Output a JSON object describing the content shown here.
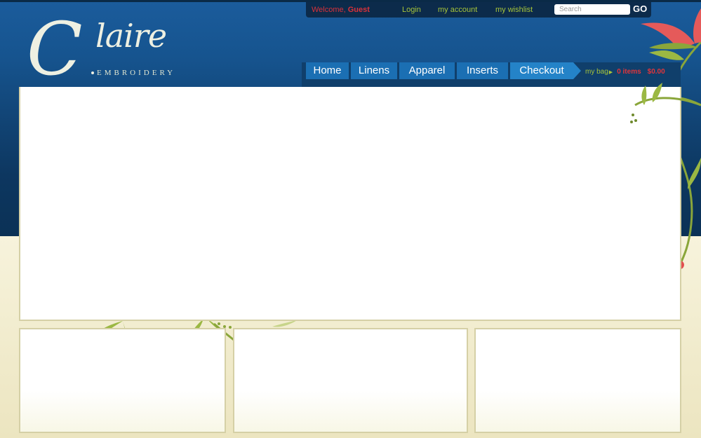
{
  "top_bar": {
    "welcome_label": "Welcome,",
    "user_name": "Guest",
    "login": "Login",
    "my_account": "my account",
    "my_wishlist": "my wishlist",
    "search_placeholder": "Search",
    "go_label": "GO"
  },
  "logo": {
    "initial": "C",
    "name": "laire",
    "tagline": "EMBROIDERY"
  },
  "nav": {
    "items": [
      "Home",
      "Linens",
      "Apparel",
      "Inserts",
      "Checkout"
    ]
  },
  "bag": {
    "label": "my bag",
    "items": "0 items",
    "total": "$0.00"
  },
  "colors": {
    "header_blue": "#1b5c9c",
    "nav_blue": "#1b6fb3",
    "accent_green": "#a6c33a",
    "accent_red": "#e0353b",
    "cream": "#f7f3dc"
  }
}
